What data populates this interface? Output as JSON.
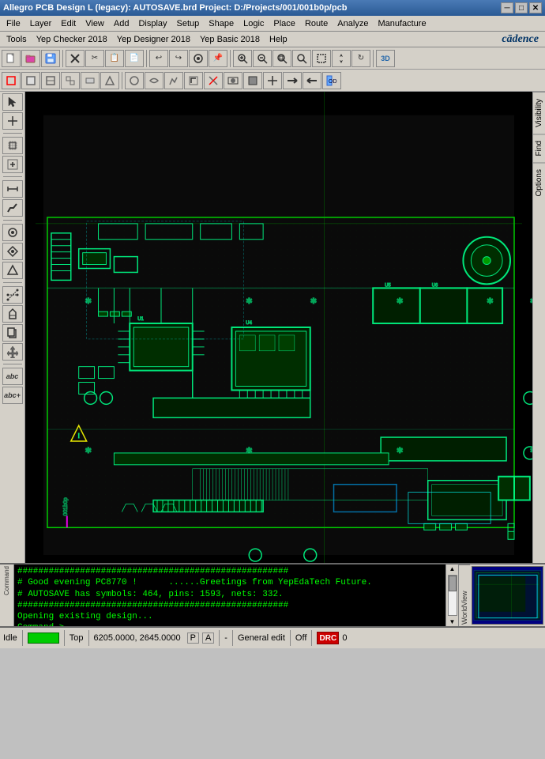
{
  "title_bar": {
    "text": "Allegro PCB Design L (legacy): AUTOSAVE.brd  Project: D:/Projects/001/001b0p/pcb",
    "minimize": "─",
    "maximize": "□",
    "close": "✕"
  },
  "menu_bar1": {
    "items": [
      "File",
      "Layer",
      "Edit",
      "View",
      "Add",
      "Display",
      "Setup",
      "Shape",
      "Logic",
      "Place",
      "Route",
      "Analyze",
      "Manufacture"
    ]
  },
  "menu_bar2": {
    "items": [
      "Tools",
      "Yep Checker 2018",
      "Yep Designer 2018",
      "Yep Basic 2018",
      "Help"
    ],
    "logo": "cādence"
  },
  "toolbar1": {
    "buttons": [
      "📁",
      "📂",
      "💾",
      "✂",
      "📋",
      "📄",
      "🔄",
      "↩",
      "↪",
      "⏸",
      "🔴",
      "📌",
      "🔍",
      "🔍",
      "🔍",
      "🔍",
      "🔍",
      "🔲",
      "🔲",
      "🔲"
    ]
  },
  "toolbar2": {
    "buttons": [
      "□",
      "□",
      "□",
      "□",
      "□",
      "□",
      "□",
      "□",
      "□",
      "□",
      "□",
      "□",
      "□",
      "□",
      "□",
      "□",
      "□",
      "□",
      "□"
    ]
  },
  "console": {
    "lines": [
      "####################################################",
      "# Good evening PC8770 !      ......Greetings from YepEdaTech Future.",
      "# AUTOSAVE has symbols: 464, pins: 1593, nets: 332.",
      "####################################################",
      "Opening existing design...",
      "Command >"
    ]
  },
  "status_bar": {
    "idle": "Idle",
    "green_indicator": "",
    "view": "Top",
    "coords": "6205.0000, 2645.0000",
    "p_indicator": "P",
    "a_indicator": "A",
    "dash": "-",
    "mode": "General edit",
    "off_label": "Off",
    "drc_label": "DRC",
    "count": "0"
  },
  "right_tabs": {
    "visibility": "Visibility",
    "find": "Find",
    "options": "Options"
  },
  "left_toolbar": {
    "buttons": [
      "↖",
      "⊕",
      "⊞",
      "↕",
      "⬡",
      "⬣",
      "⬤",
      "⬢",
      "⬛",
      "⬜",
      "⊿",
      "△",
      "◁",
      "◈",
      "◉",
      "○",
      "⊙",
      "⊚",
      "⊛",
      "⊜",
      "⊝",
      "abc",
      "abc+"
    ]
  },
  "minimap": {
    "label": "WorldView"
  }
}
